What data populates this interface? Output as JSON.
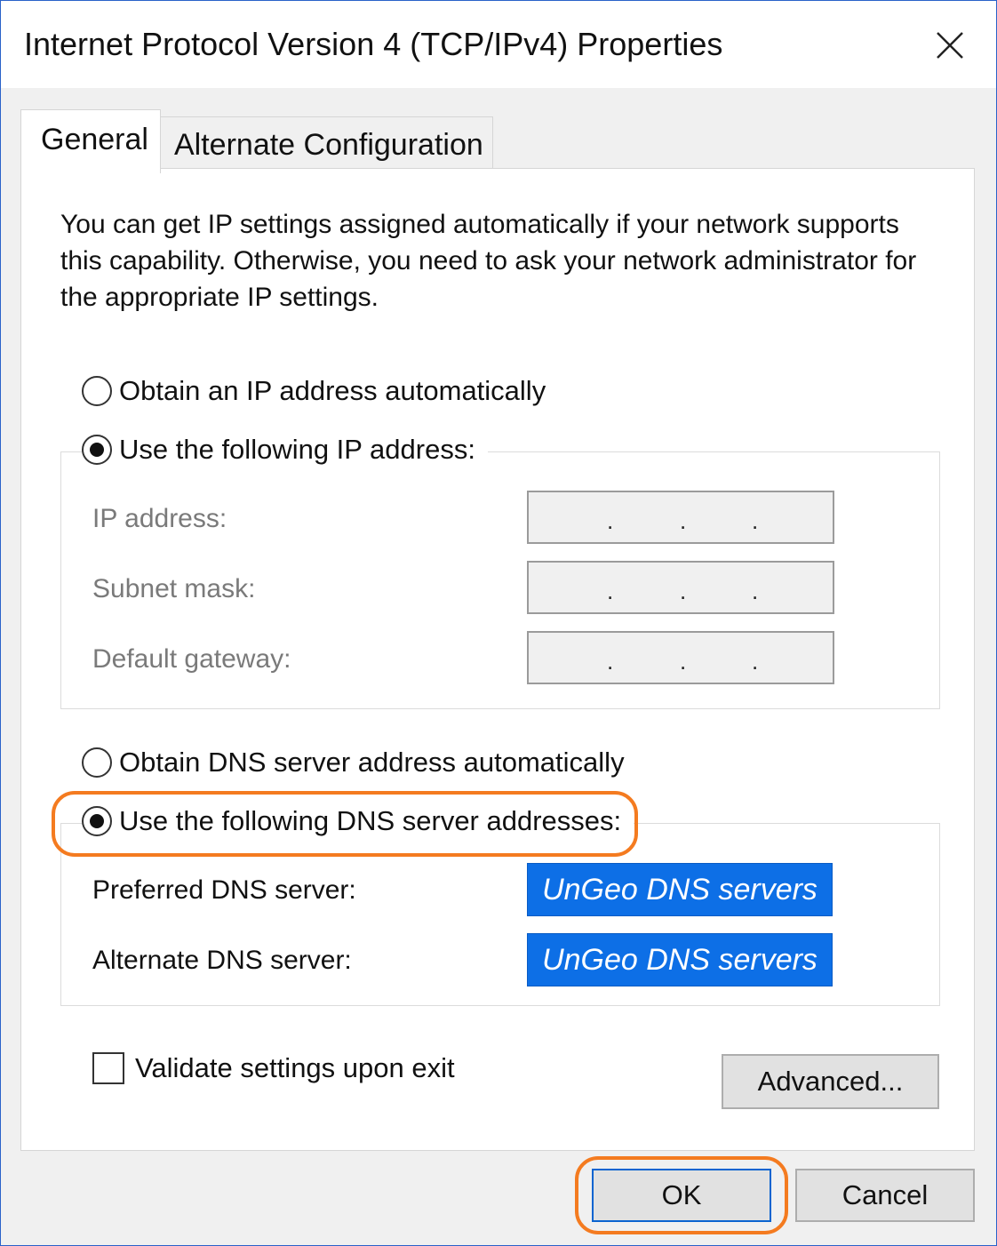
{
  "window": {
    "title": "Internet Protocol Version 4 (TCP/IPv4) Properties",
    "close_icon": "close-icon"
  },
  "tabs": [
    {
      "label": "General",
      "selected": true
    },
    {
      "label": "Alternate Configuration",
      "selected": false
    }
  ],
  "general": {
    "intro": "You can get IP settings assigned automatically if your network supports this capability. Otherwise, you need to ask your network administrator for the appropriate IP settings.",
    "ip_mode": {
      "auto_label": "Obtain an IP address automatically",
      "manual_label": "Use the following IP address:",
      "selected": "manual"
    },
    "ip_fields": [
      {
        "label": "IP address:",
        "value": ". . ."
      },
      {
        "label": "Subnet mask:",
        "value": ". . ."
      },
      {
        "label": "Default gateway:",
        "value": ". . ."
      }
    ],
    "dns_mode": {
      "auto_label": "Obtain DNS server address automatically",
      "manual_label": "Use the following DNS server addresses:",
      "selected": "manual"
    },
    "dns_fields": [
      {
        "label": "Preferred DNS server:",
        "value": "UnGeo DNS servers"
      },
      {
        "label": "Alternate DNS server:",
        "value": "UnGeo DNS servers"
      }
    ],
    "validate_label": "Validate settings upon exit",
    "validate_checked": false,
    "advanced_label": "Advanced..."
  },
  "footer": {
    "ok_label": "OK",
    "cancel_label": "Cancel"
  },
  "colors": {
    "accent": "#0d6fe6",
    "highlight": "#f47b20",
    "window_border": "#2a62c9"
  }
}
